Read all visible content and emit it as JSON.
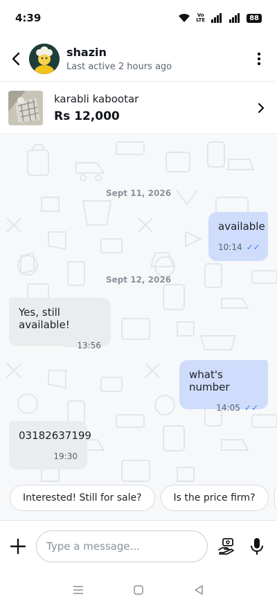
{
  "status_bar": {
    "time": "4:39",
    "volte_top": "Vo",
    "volte_bottom": "LTE",
    "battery": "88"
  },
  "header": {
    "name": "shazin",
    "status": "Last active 2 hours ago",
    "back_icon": "back-arrow-icon",
    "menu_icon": "more-vertical-icon"
  },
  "product": {
    "title": "karabli kabootar",
    "price": "Rs 12,000"
  },
  "chat": {
    "dates": [
      "Sept 11, 2026",
      "Sept 12, 2026"
    ],
    "messages": [
      {
        "sender": "me",
        "text": "available",
        "time": "10:14",
        "status": "read"
      },
      {
        "sender": "them",
        "text": "Yes, still available!",
        "time": "13:56"
      },
      {
        "sender": "me",
        "text": "what's number",
        "time": "14:05",
        "status": "read"
      },
      {
        "sender": "them",
        "text": "03182637199",
        "time": "19:30"
      }
    ],
    "quick_replies": [
      "Interested! Still for sale?",
      "Is the price firm?"
    ]
  },
  "composer": {
    "placeholder": "Type a message..."
  },
  "colors": {
    "sent_bubble": "#cfdcfb",
    "received_bubble": "#ebeced",
    "read_ticks": "#3c84e6",
    "chat_background": "#f6f8fa"
  }
}
